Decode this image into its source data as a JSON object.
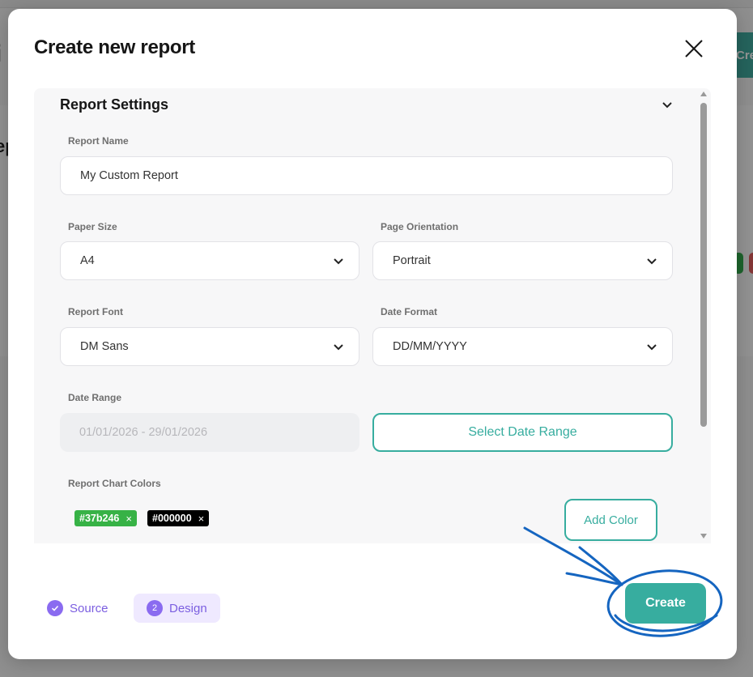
{
  "background": {
    "app_title_fragment": "i",
    "sub_fragment": "ep",
    "create_fragment": "Cre"
  },
  "modal": {
    "title": "Create new report",
    "close_icon": "close-icon"
  },
  "section": {
    "title": "Report Settings",
    "expanded": true
  },
  "fields": {
    "report_name": {
      "label": "Report Name",
      "value": "My Custom Report"
    },
    "paper_size": {
      "label": "Paper Size",
      "value": "A4"
    },
    "page_orientation": {
      "label": "Page Orientation",
      "value": "Portrait"
    },
    "report_font": {
      "label": "Report Font",
      "value": "DM Sans"
    },
    "date_format": {
      "label": "Date Format",
      "value": "DD/MM/YYYY"
    },
    "date_range": {
      "label": "Date Range",
      "value": "01/01/2026 - 29/01/2026",
      "button": "Select Date Range"
    },
    "chart_colors": {
      "label": "Report Chart Colors",
      "colors": [
        {
          "hex": "#37b246",
          "label": "#37b246",
          "remove": "×"
        },
        {
          "hex": "#000000",
          "label": "#000000",
          "remove": "×"
        }
      ],
      "add_button": "Add Color"
    }
  },
  "steps": [
    {
      "label": "Source",
      "icon": "check-icon",
      "state": "done"
    },
    {
      "label": "Design",
      "number": "2",
      "state": "active"
    }
  ],
  "footer": {
    "create_label": "Create"
  },
  "colors": {
    "accent": "#37ad9f",
    "step_purple": "#8a6bf0",
    "annotation_blue": "#1565c0"
  }
}
